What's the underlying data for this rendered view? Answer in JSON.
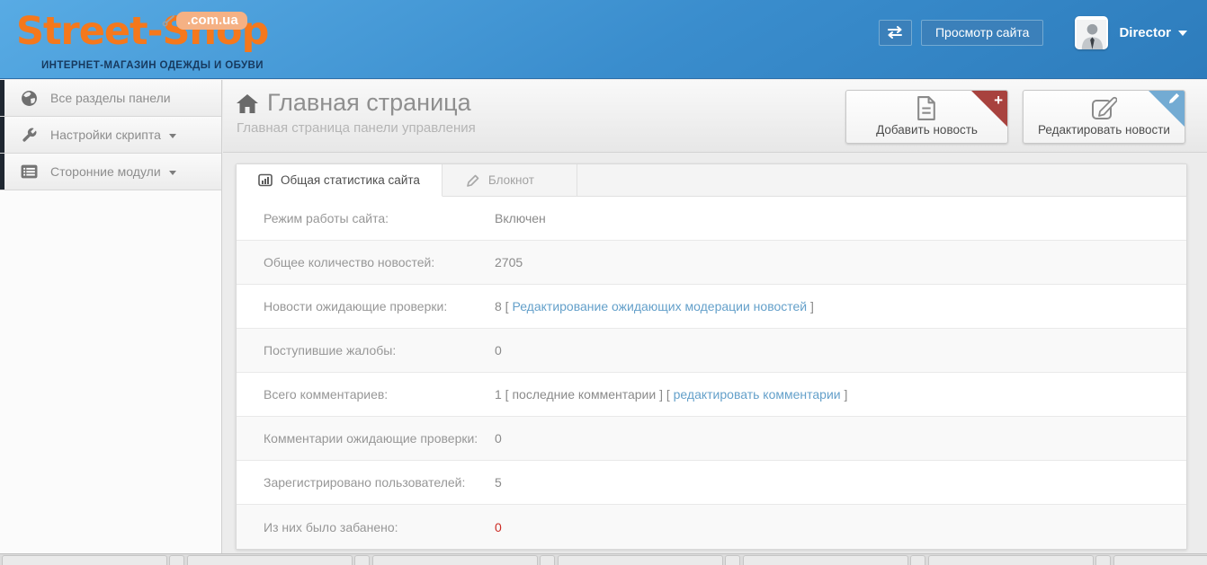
{
  "header": {
    "logo": {
      "brand": "Street-Shop",
      "domain_badge": ".com.ua",
      "tagline": "ИНТЕРНЕТ-МАГАЗИН ОДЕЖДЫ И ОБУВИ"
    },
    "toggle_icon": "swap-arrows-icon",
    "view_site_label": "Просмотр сайта",
    "user": {
      "name": "Director",
      "avatar_icon": "person-photo-icon"
    }
  },
  "sidebar": {
    "items": [
      {
        "id": "all-sections",
        "label": "Все разделы панели",
        "icon": "globe-icon",
        "has_caret": false
      },
      {
        "id": "script-settings",
        "label": "Настройки скрипта",
        "icon": "wrench-icon",
        "has_caret": true
      },
      {
        "id": "third-party-modules",
        "label": "Сторонние модули",
        "icon": "list-icon",
        "has_caret": true
      }
    ]
  },
  "page": {
    "title": "Главная страница",
    "subtitle": "Главная страница панели управления",
    "title_icon": "home-icon",
    "actions": [
      {
        "id": "add-news",
        "label": "Добавить новость",
        "icon": "document-icon",
        "ribbon_icon": "plus-icon",
        "ribbon_color": "#a8423e"
      },
      {
        "id": "edit-news",
        "label": "Редактировать новости",
        "icon": "edit-icon",
        "ribbon_icon": "pencil-icon",
        "ribbon_color": "#73abd3"
      }
    ]
  },
  "tabs": [
    {
      "id": "site-stats",
      "label": "Общая статистика сайта",
      "icon": "bar-chart-icon",
      "active": true
    },
    {
      "id": "notepad",
      "label": "Блокнот",
      "icon": "pencil-icon",
      "active": false
    }
  ],
  "stats": {
    "rows": [
      {
        "label": "Режим работы сайта:",
        "segments": [
          {
            "text": "Включен",
            "style": "plain"
          }
        ]
      },
      {
        "label": "Общее количество новостей:",
        "segments": [
          {
            "text": "2705",
            "style": "plain"
          }
        ]
      },
      {
        "label": "Новости ожидающие проверки:",
        "segments": [
          {
            "text": "8 [ ",
            "style": "plain"
          },
          {
            "text": "Редактирование ожидающих модерации новостей",
            "style": "link"
          },
          {
            "text": " ]",
            "style": "plain"
          }
        ]
      },
      {
        "label": "Поступившие жалобы:",
        "segments": [
          {
            "text": "0",
            "style": "plain"
          }
        ]
      },
      {
        "label": "Всего комментариев:",
        "segments": [
          {
            "text": "1 [ ",
            "style": "plain"
          },
          {
            "text": "последние комментарии",
            "style": "link-muted"
          },
          {
            "text": " ] [ ",
            "style": "plain"
          },
          {
            "text": "редактировать комментарии",
            "style": "link"
          },
          {
            "text": " ]",
            "style": "plain"
          }
        ]
      },
      {
        "label": "Комментарии ожидающие проверки:",
        "segments": [
          {
            "text": "0",
            "style": "plain"
          }
        ]
      },
      {
        "label": "Зарегистрировано пользователей:",
        "segments": [
          {
            "text": "5",
            "style": "plain"
          }
        ]
      },
      {
        "label": "Из них было забанено:",
        "segments": [
          {
            "text": "0",
            "style": "danger"
          }
        ]
      }
    ]
  },
  "footer_strip": {
    "box_pairs": 7
  },
  "colors": {
    "header_blue_top": "#58abe4",
    "header_blue_bottom": "#2d7cbc",
    "logo_orange": "#f5781c",
    "badge_peach": "#f5b184",
    "tagline_navy": "#17395e",
    "link_blue": "#64a0ca",
    "danger_red": "#cc2b24",
    "ribbon_red": "#a8423e",
    "ribbon_blue": "#73abd3"
  }
}
